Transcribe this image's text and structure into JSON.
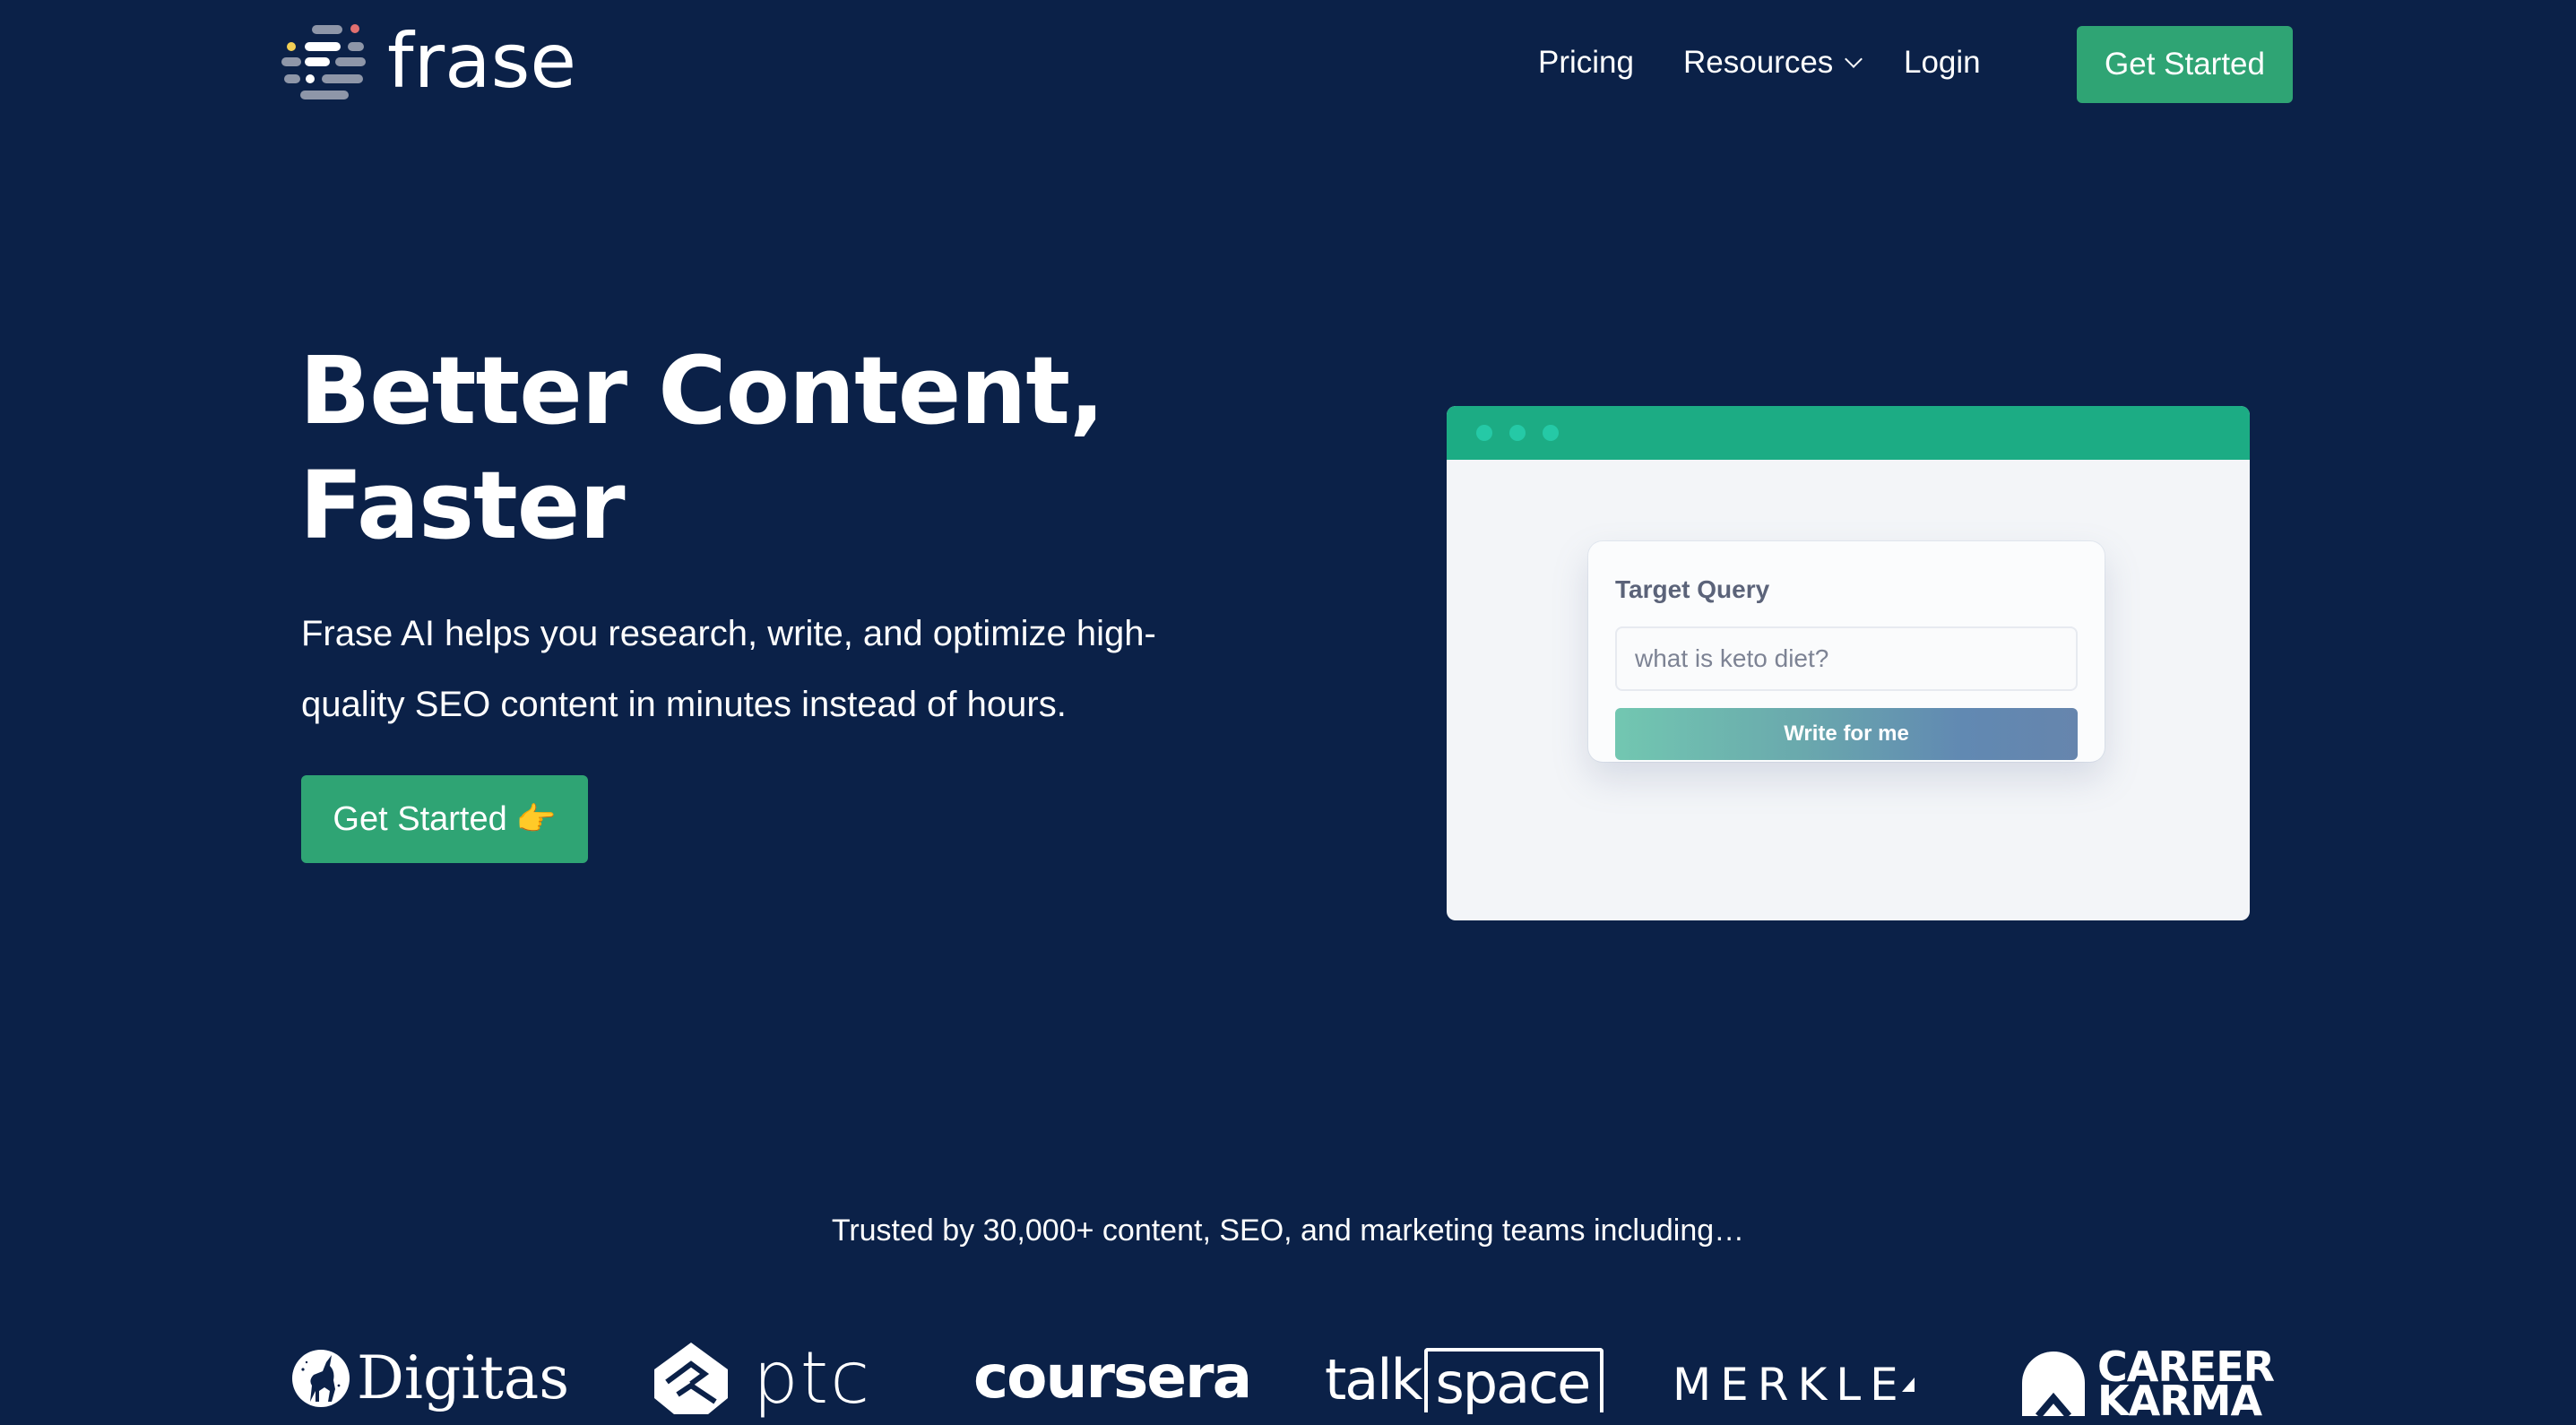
{
  "nav": {
    "brand": "frase",
    "links": [
      {
        "label": "Pricing"
      },
      {
        "label": "Resources",
        "has_dropdown": true
      },
      {
        "label": "Login"
      }
    ],
    "cta_label": "Get Started"
  },
  "hero": {
    "title_line1": "Better Content,",
    "title_line2": "Faster",
    "subtitle_line1": "Frase AI helps you research, write, and optimize high-",
    "subtitle_line2": "quality SEO content in minutes instead of hours.",
    "cta_label": "Get Started",
    "cta_emoji": "👉"
  },
  "mockup": {
    "field_label": "Target Query",
    "input_placeholder": "what is keto diet?",
    "button_label": "Write for me"
  },
  "trusted": {
    "text": "Trusted by 30,000+ content, SEO, and marketing teams including…",
    "logos": [
      {
        "name": "Digitas",
        "text": "Digitas"
      },
      {
        "name": "ptc",
        "text": "ptc"
      },
      {
        "name": "coursera",
        "text": "coursera"
      },
      {
        "name": "talkspace",
        "text_a": "talk",
        "text_b": "space"
      },
      {
        "name": "Merkle",
        "text": "MERKLE"
      },
      {
        "name": "Career Karma",
        "line1": "CAREER",
        "line2": "KARMA"
      }
    ]
  },
  "colors": {
    "background": "#0b2148",
    "primary_green": "#2fa474",
    "mockup_bar": "#1cac84",
    "mockup_dot": "#25c9a6",
    "logo_red": "#e27070",
    "logo_yellow": "#f3cf55",
    "logo_gray": "#8e96a8"
  }
}
